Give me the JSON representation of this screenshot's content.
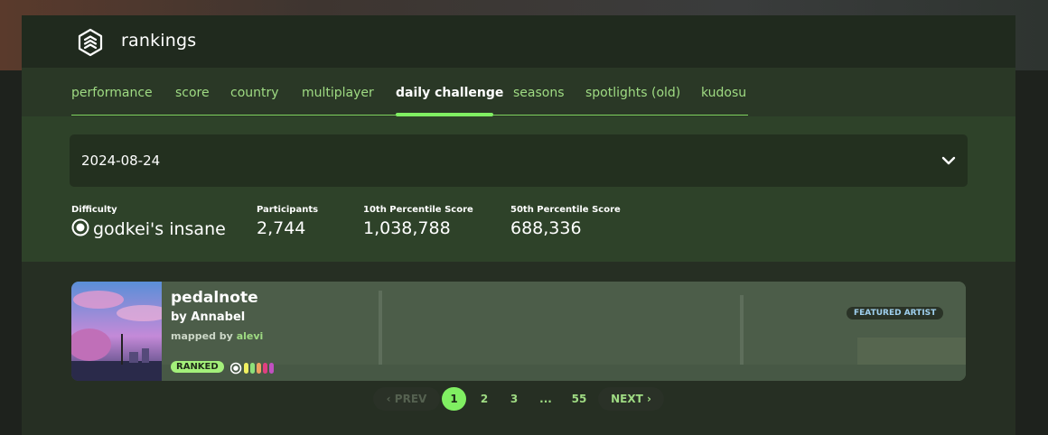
{
  "header": {
    "title": "rankings",
    "logo_icon": "rankings-icon"
  },
  "tabs": [
    {
      "label": "performance"
    },
    {
      "label": "score"
    },
    {
      "label": "country"
    },
    {
      "label": "multiplayer"
    },
    {
      "label": "daily challenge",
      "active": true
    },
    {
      "label": "seasons"
    },
    {
      "label": "spotlights (old)"
    },
    {
      "label": "kudosu"
    }
  ],
  "filter": {
    "selected_date": "2024-08-24",
    "prev_icon": "arrow-left-icon",
    "next_icon": "arrow-right-icon",
    "dropdown_icon": "chevron-down-icon"
  },
  "stats": {
    "difficulty_label": "Difficulty",
    "difficulty_value": "godkei's insane",
    "participants_label": "Participants",
    "participants_value": "2,744",
    "p10_label": "10th Percentile Score",
    "p10_value": "1,038,788",
    "p50_label": "50th Percentile Score",
    "p50_value": "688,336"
  },
  "beatmap": {
    "title": "pedalnote",
    "artist": "by Annabel",
    "mapped_by_prefix": "mapped by",
    "mapper": "alevi",
    "status": "RANKED",
    "badge": "FEATURED ARTIST",
    "difficulty_colors": [
      "#ffffff",
      "#f0f060",
      "#8de07a",
      "#f0a060",
      "#e04080",
      "#c050c0"
    ]
  },
  "pagination": {
    "prev": "PREV",
    "next": "NEXT",
    "pages": [
      "1",
      "2",
      "3",
      "...",
      "55"
    ],
    "current": "1"
  },
  "colors": {
    "accent": "#80ef62",
    "tab_text": "#9fdb83",
    "arrow": "#ff33cc"
  }
}
